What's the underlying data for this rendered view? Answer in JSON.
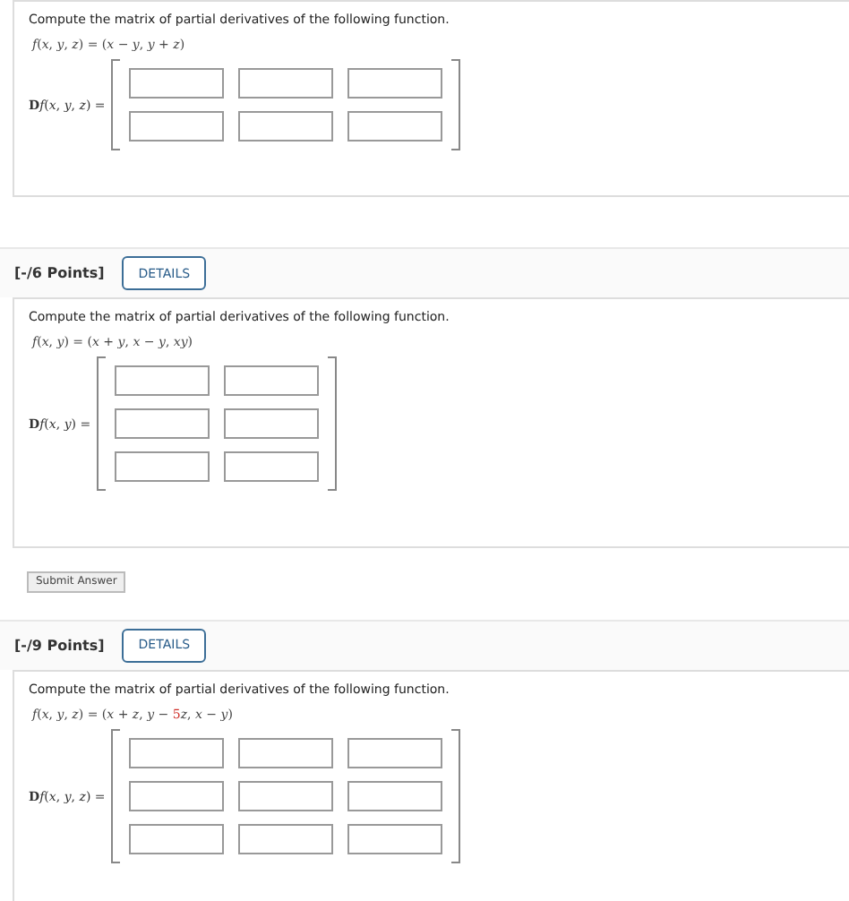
{
  "questions": [
    {
      "prompt": "Compute the matrix of partial derivatives of the following function.",
      "function": [
        {
          "text": "*f*(*x*, *y*, *z*) = (*x* − *y*, *y* + *z*)",
          "highlight": false
        }
      ],
      "derivative_label": {
        "operator": "D",
        "text": "*f*(*x*, *y*, *z*) ="
      },
      "matrix": [
        [
          {
            "kind": "blank"
          },
          {
            "kind": "blank"
          },
          {
            "kind": "blank"
          }
        ],
        [
          {
            "kind": "blank"
          },
          {
            "kind": "blank"
          },
          {
            "kind": "blank"
          }
        ]
      ]
    },
    {
      "header": {
        "points": "[-/6 Points]",
        "button": "DETAILS"
      },
      "prompt": "Compute the matrix of partial derivatives of the following function.",
      "function": [
        {
          "text": "*f*(*x*, *y*) = (*x* + *y*, *x* − *y*, *xy*)",
          "highlight": false
        }
      ],
      "derivative_label": {
        "operator": "D",
        "text": "*f*(*x*, *y*) ="
      },
      "matrix": [
        [
          {
            "kind": "blank"
          },
          {
            "kind": "blank"
          }
        ],
        [
          {
            "kind": "blank"
          },
          {
            "kind": "blank"
          }
        ],
        [
          {
            "kind": "blank"
          },
          {
            "kind": "blank"
          }
        ]
      ],
      "submit": "Submit Answer"
    },
    {
      "header": {
        "points": "[-/9 Points]",
        "button": "DETAILS"
      },
      "prompt": "Compute the matrix of partial derivatives of the following function.",
      "function": [
        {
          "text": "*f*(*x*, *y*, *z*) = (*x* + *z*, *y* − ",
          "highlight": false
        },
        {
          "text": "5",
          "highlight": true
        },
        {
          "text": "*z*, *x* − *y*)",
          "highlight": false
        }
      ],
      "derivative_label": {
        "operator": "D",
        "text": "*f*(*x*, *y*, *z*) ="
      },
      "matrix": [
        [
          {
            "kind": "blank"
          },
          {
            "kind": "blank"
          },
          {
            "kind": "blank"
          }
        ],
        [
          {
            "kind": "blank"
          },
          {
            "kind": "blank"
          },
          {
            "kind": "blank"
          }
        ],
        [
          {
            "kind": "blank"
          },
          {
            "kind": "blank"
          },
          {
            "kind": "blank"
          }
        ]
      ]
    }
  ]
}
